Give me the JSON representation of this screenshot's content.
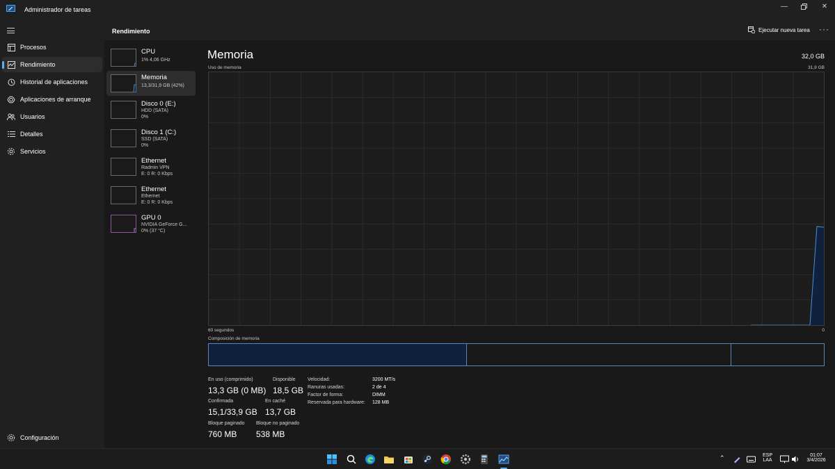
{
  "window": {
    "title": "Administrador de tareas"
  },
  "sidebar": {
    "items": [
      {
        "label": "Procesos",
        "icon": "processes-icon"
      },
      {
        "label": "Rendimiento",
        "icon": "performance-icon",
        "active": true
      },
      {
        "label": "Historial de aplicaciones",
        "icon": "history-icon"
      },
      {
        "label": "Aplicaciones de arranque",
        "icon": "startup-icon"
      },
      {
        "label": "Usuarios",
        "icon": "users-icon"
      },
      {
        "label": "Detalles",
        "icon": "details-icon"
      },
      {
        "label": "Servicios",
        "icon": "services-icon"
      }
    ],
    "settings_label": "Configuración"
  },
  "header": {
    "title": "Rendimiento",
    "run_task_label": "Ejecutar nueva tarea",
    "more": "···"
  },
  "devices": [
    {
      "name": "CPU",
      "lines": [
        "1%  4,06 GHz"
      ]
    },
    {
      "name": "Memoria",
      "lines": [
        "13,3/31,9 GB (42%)"
      ],
      "active": true
    },
    {
      "name": "Disco 0 (E:)",
      "lines": [
        "HDD (SATA)",
        "0%"
      ]
    },
    {
      "name": "Disco 1 (C:)",
      "lines": [
        "SSD (SATA)",
        "0%"
      ]
    },
    {
      "name": "Ethernet",
      "lines": [
        "Radmin VPN",
        "E: 0  R: 0 Kbps"
      ]
    },
    {
      "name": "Ethernet",
      "lines": [
        "Ethernet",
        "E: 0  R: 0 Kbps"
      ]
    },
    {
      "name": "GPU 0",
      "lines": [
        "NVIDIA GeForce G...",
        "0% (37 °C)"
      ]
    }
  ],
  "memory": {
    "title": "Memoria",
    "total": "32,0 GB",
    "usage_label": "Uso de memoria",
    "usage_max": "31,9 GB",
    "time_left": "60 segundos",
    "time_right": "0",
    "composition_label": "Composición de memoria",
    "composition_fractions": [
      0.42,
      0.43,
      0.15
    ],
    "usage_history_fraction": [
      0,
      0,
      0,
      0.42,
      0.418,
      0.417,
      0.417,
      0.417
    ],
    "stats": {
      "in_use_label": "En uso (comprimido)",
      "in_use": "13,3 GB (0 MB)",
      "available_label": "Disponible",
      "available": "18,5 GB",
      "committed_label": "Confirmada",
      "committed": "15,1/33,9 GB",
      "cached_label": "En caché",
      "cached": "13,7 GB",
      "paged_label": "Bloque paginado",
      "paged": "760 MB",
      "nonpaged_label": "Bloque no paginado",
      "nonpaged": "538 MB"
    },
    "specs": [
      {
        "label": "Velocidad:",
        "value": "3200 MT/s"
      },
      {
        "label": "Ranuras usadas:",
        "value": "2 de 4"
      },
      {
        "label": "Factor de forma:",
        "value": "DIMM"
      },
      {
        "label": "Reservada para hardware:",
        "value": "128 MB"
      }
    ]
  },
  "taskbar": {
    "lang": "ESP",
    "layout": "LAA",
    "time": "01:07",
    "date": "3/4/2026"
  },
  "colors": {
    "accent": "#60b0f0",
    "memory_line": "#4a8fd0",
    "memory_fill": "#10213d",
    "bg": "#191919"
  }
}
